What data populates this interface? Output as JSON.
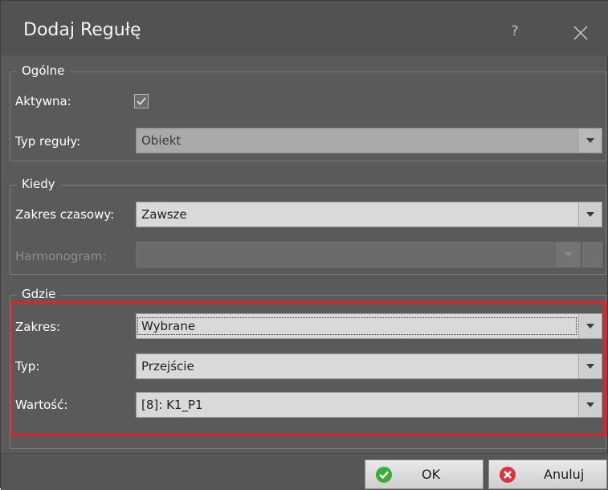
{
  "dialog": {
    "title": "Dodaj Regułę",
    "help_label": "?"
  },
  "general": {
    "legend": "Ogólne",
    "active_label": "Aktywna:",
    "active_checked": true,
    "rule_type_label": "Typ reguły:",
    "rule_type_value": "Obiekt"
  },
  "when": {
    "legend": "Kiedy",
    "time_range_label": "Zakres czasowy:",
    "time_range_value": "Zawsze",
    "schedule_label": "Harmonogram:",
    "schedule_value": ""
  },
  "where": {
    "legend": "Gdzie",
    "scope_label": "Zakres:",
    "scope_value": "Wybrane",
    "type_label": "Typ:",
    "type_value": "Przejście",
    "value_label": "Wartość:",
    "value_value": "[8]: K1_P1"
  },
  "buttons": {
    "ok_label": "OK",
    "cancel_label": "Anuluj"
  },
  "colors": {
    "dialog_bg": "#5a5a5a",
    "highlight": "#e6202c",
    "ok_icon": "#3cae3c",
    "cancel_icon": "#d9343f"
  }
}
